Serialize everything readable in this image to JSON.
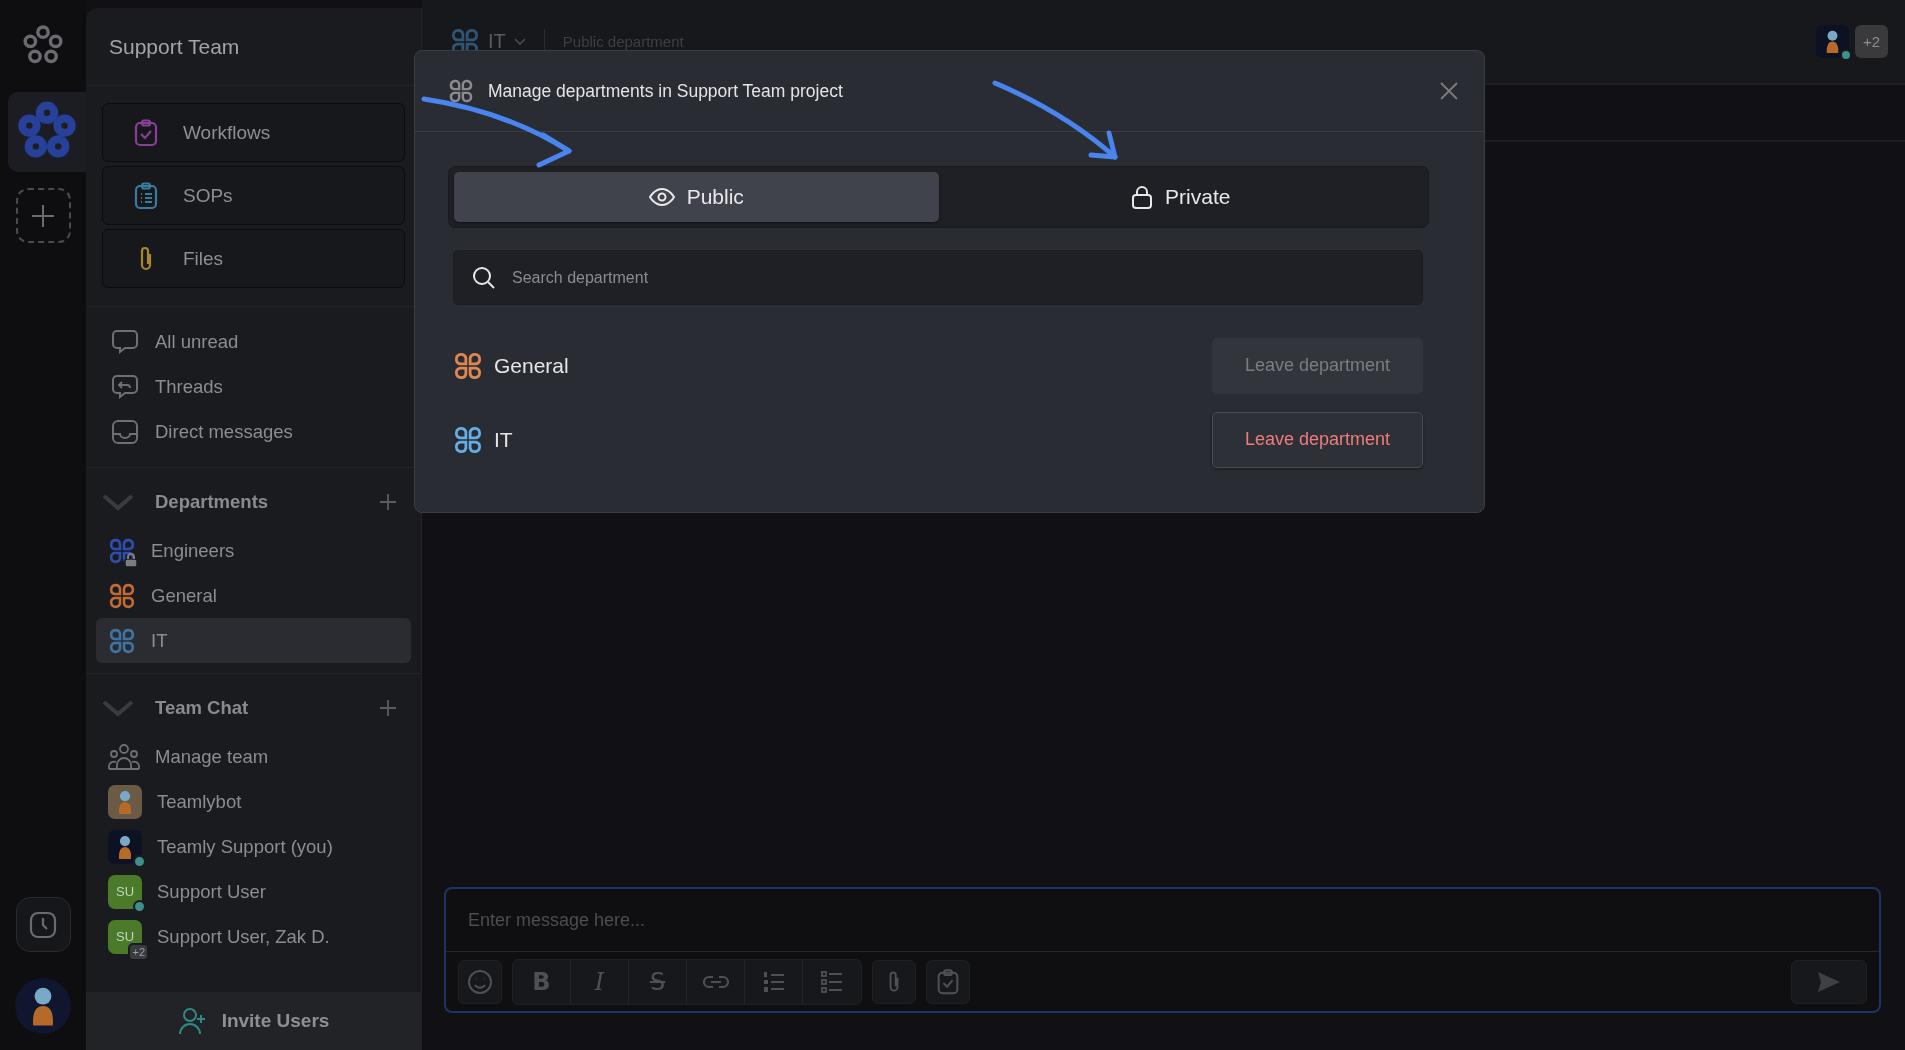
{
  "rail": {
    "workspaces": [
      {
        "selected": true
      }
    ]
  },
  "sidebar": {
    "title": "Support Team",
    "tools": [
      {
        "kind": "workflows",
        "label": "Workflows"
      },
      {
        "kind": "sops",
        "label": "SOPs"
      },
      {
        "kind": "files",
        "label": "Files"
      }
    ],
    "views": [
      {
        "kind": "unread",
        "label": "All unread"
      },
      {
        "kind": "threads",
        "label": "Threads"
      },
      {
        "kind": "direct",
        "label": "Direct messages"
      }
    ],
    "departments": {
      "title": "Departments",
      "expanded": true,
      "items": [
        {
          "name": "Engineers",
          "color": "#2f4db0",
          "private": true,
          "selected": false
        },
        {
          "name": "General",
          "color": "#c06a36",
          "private": false,
          "selected": false
        },
        {
          "name": "IT",
          "color": "#3f74a0",
          "private": false,
          "selected": true
        }
      ]
    },
    "team_chat": {
      "title": "Team Chat",
      "expanded": true,
      "items": [
        {
          "kind": "manage",
          "name": "Manage team"
        },
        {
          "kind": "bot",
          "name": "Teamlybot"
        },
        {
          "kind": "user",
          "name": "Teamly Support (you)",
          "online": true
        },
        {
          "kind": "initials",
          "initials": "SU",
          "name": "Support User",
          "online": true
        },
        {
          "kind": "group",
          "initials": "SU",
          "extra": "+2",
          "name": "Support User, Zak D."
        }
      ]
    },
    "invite_button": "Invite Users"
  },
  "header": {
    "channel": "IT",
    "subtitle": "Public department",
    "member_extra": "+2"
  },
  "composer": {
    "placeholder": "Enter message here...",
    "format_tools": [
      {
        "kind": "bold",
        "glyph": "B"
      },
      {
        "kind": "italic",
        "glyph": "I"
      },
      {
        "kind": "strike",
        "glyph": "S"
      }
    ]
  },
  "modal": {
    "title": "Manage departments in Support Team project",
    "tabs": [
      {
        "kind": "public",
        "label": "Public",
        "selected": true
      },
      {
        "kind": "private",
        "label": "Private",
        "selected": false
      }
    ],
    "search": {
      "placeholder": "Search department"
    },
    "departments": [
      {
        "name": "General",
        "color": "#e0874f",
        "action": "Leave department",
        "disabled": true
      },
      {
        "name": "IT",
        "color": "#62aee6",
        "action": "Leave department",
        "disabled": false
      }
    ]
  }
}
